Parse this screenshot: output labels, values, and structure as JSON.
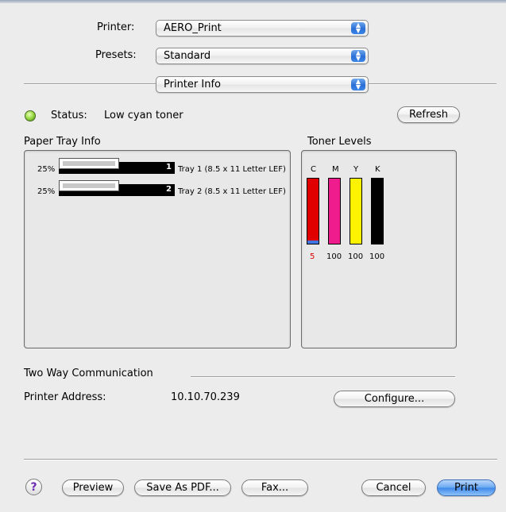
{
  "printer": {
    "label": "Printer:",
    "value": "AERO_Print"
  },
  "presets": {
    "label": "Presets:",
    "value": "Standard"
  },
  "panel": {
    "value": "Printer Info"
  },
  "status": {
    "label": "Status:",
    "value": "Low cyan toner",
    "refresh": "Refresh"
  },
  "paper_tray": {
    "title": "Paper Tray Info",
    "trays": [
      {
        "percent": "25%",
        "number": "1",
        "name": "Tray 1 (8.5 x 11 Letter LEF)",
        "level": 0.25
      },
      {
        "percent": "25%",
        "number": "2",
        "name": "Tray 2 (8.5 x 11 Letter LEF)",
        "level": 0.25
      }
    ]
  },
  "toner": {
    "title": "Toner Levels",
    "colors": [
      {
        "letter": "C",
        "value": "5",
        "level": 0.05,
        "color": "#e00000",
        "value_color": "#e00000"
      },
      {
        "letter": "M",
        "value": "100",
        "level": 1.0,
        "color": "#ee1c8c",
        "value_color": "#000000"
      },
      {
        "letter": "Y",
        "value": "100",
        "level": 1.0,
        "color": "#fff200",
        "value_color": "#000000"
      },
      {
        "letter": "K",
        "value": "100",
        "level": 1.0,
        "color": "#000000",
        "value_color": "#000000"
      }
    ]
  },
  "two_way": {
    "title": "Two Way Communication",
    "address_label": "Printer Address:",
    "address": "10.10.70.239",
    "configure": "Configure..."
  },
  "footer": {
    "help": "?",
    "preview": "Preview",
    "save_pdf": "Save As PDF...",
    "fax": "Fax...",
    "cancel": "Cancel",
    "print": "Print"
  }
}
